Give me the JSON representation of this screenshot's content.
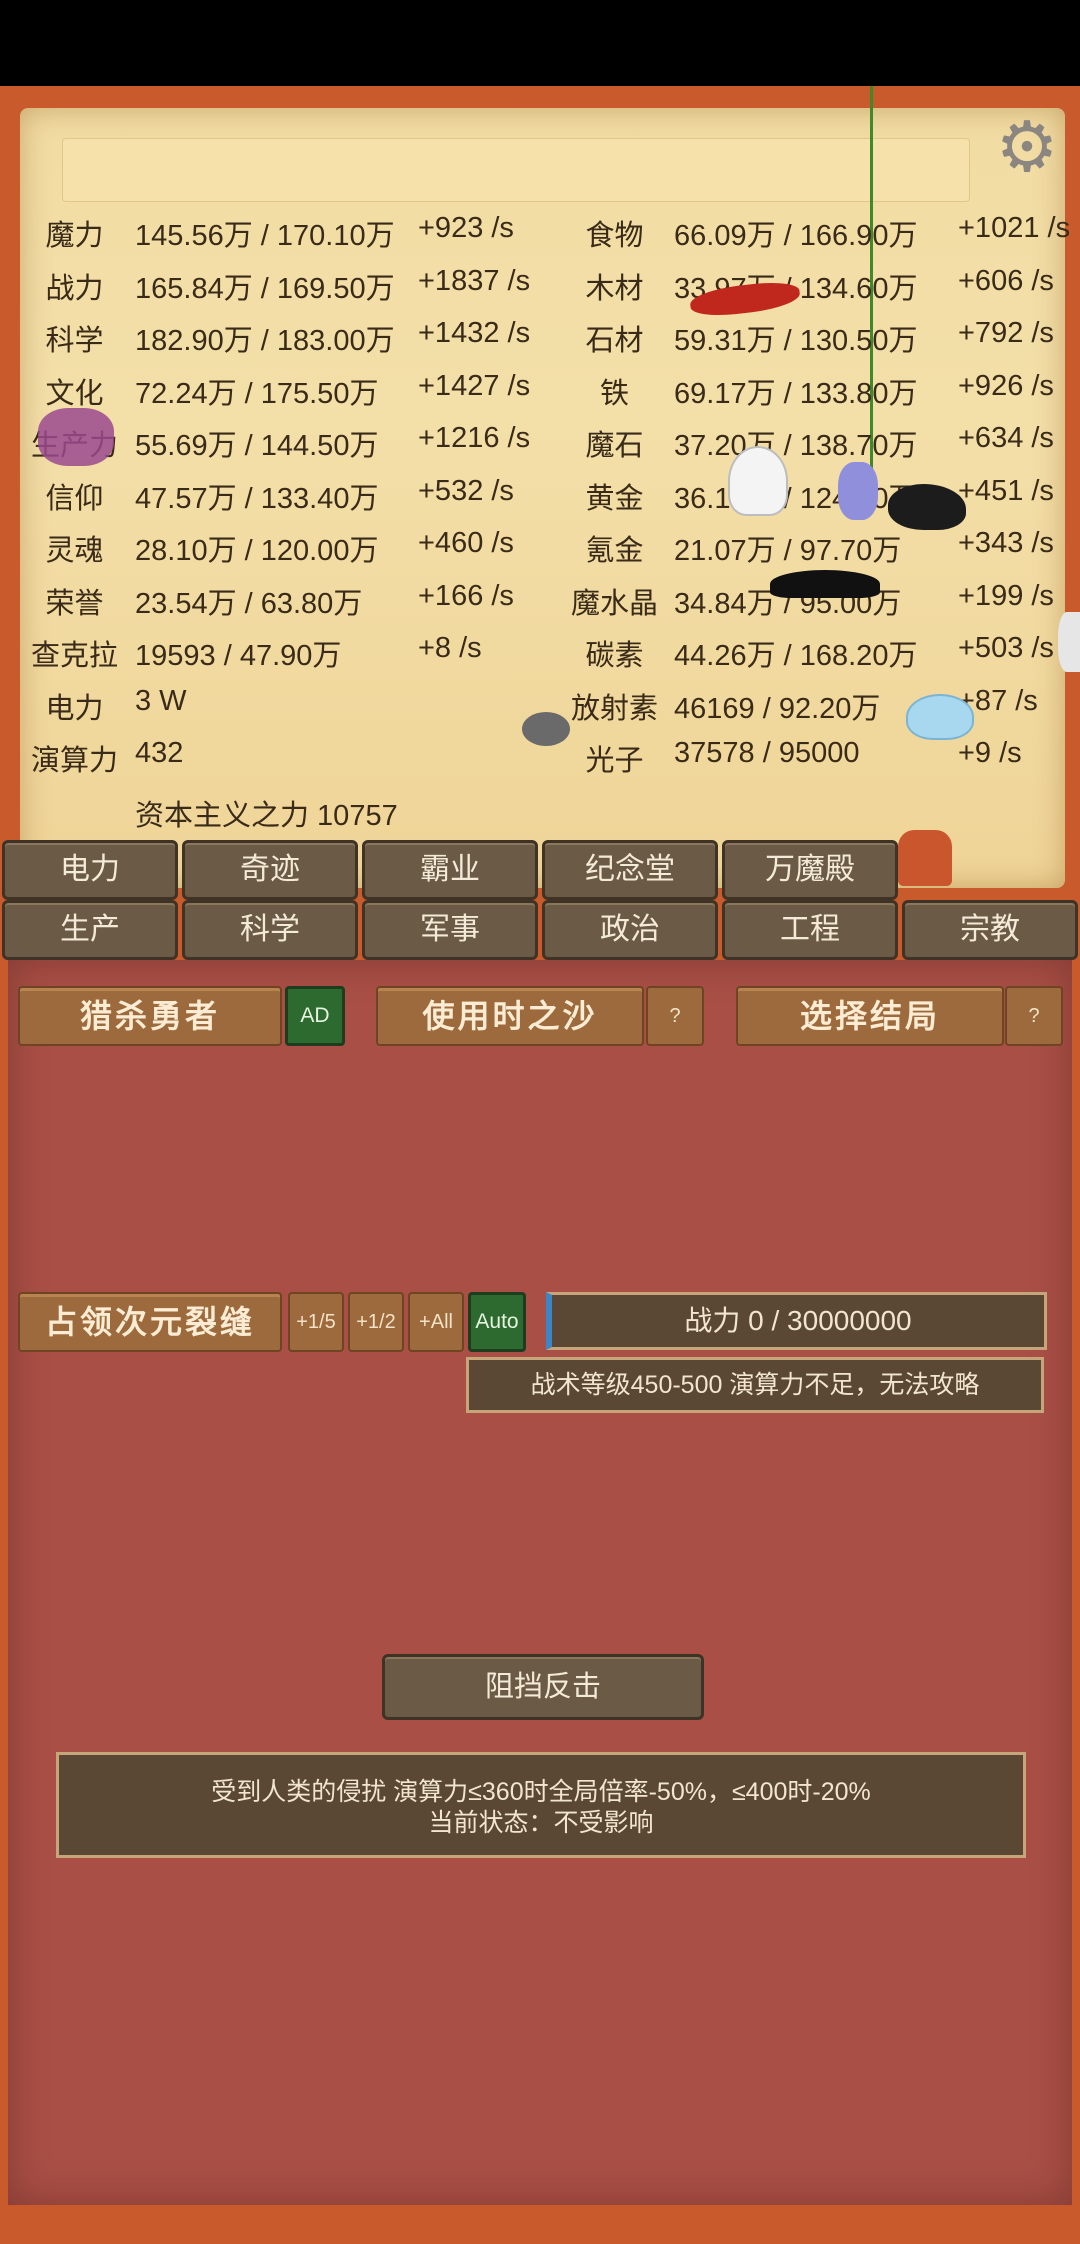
{
  "stats_left": [
    {
      "label": "魔力",
      "value": "145.56万 / 170.10万",
      "rate": "+923 /s"
    },
    {
      "label": "战力",
      "value": "165.84万 / 169.50万",
      "rate": "+1837 /s"
    },
    {
      "label": "科学",
      "value": "182.90万 / 183.00万",
      "rate": "+1432 /s"
    },
    {
      "label": "文化",
      "value": "72.24万 / 175.50万",
      "rate": "+1427 /s"
    },
    {
      "label": "生产力",
      "value": "55.69万 / 144.50万",
      "rate": "+1216 /s"
    },
    {
      "label": "信仰",
      "value": "47.57万 / 133.40万",
      "rate": "+532 /s"
    },
    {
      "label": "灵魂",
      "value": "28.10万 / 120.00万",
      "rate": "+460 /s"
    },
    {
      "label": "荣誉",
      "value": "23.54万 / 63.80万",
      "rate": "+166 /s"
    },
    {
      "label": "查克拉",
      "value": "19593 / 47.90万",
      "rate": "+8 /s"
    },
    {
      "label": "电力",
      "value": "3 W",
      "rate": ""
    },
    {
      "label": "演算力",
      "value": "432",
      "rate": ""
    }
  ],
  "stats_right": [
    {
      "label": "食物",
      "value": "66.09万 / 166.90万",
      "rate": "+1021 /s"
    },
    {
      "label": "木材",
      "value": "33.97万 / 134.60万",
      "rate": "+606 /s"
    },
    {
      "label": "石材",
      "value": "59.31万 / 130.50万",
      "rate": "+792 /s"
    },
    {
      "label": "铁",
      "value": "69.17万 / 133.80万",
      "rate": "+926 /s"
    },
    {
      "label": "魔石",
      "value": "37.20万 / 138.70万",
      "rate": "+634 /s"
    },
    {
      "label": "黄金",
      "value": "36.16万 / 124.40万",
      "rate": "+451 /s"
    },
    {
      "label": "氪金",
      "value": "21.07万 / 97.70万",
      "rate": "+343 /s"
    },
    {
      "label": "魔水晶",
      "value": "34.84万 / 95.00万",
      "rate": "+199 /s"
    },
    {
      "label": "碳素",
      "value": "44.26万 / 168.20万",
      "rate": "+503 /s"
    },
    {
      "label": "放射素",
      "value": "46169 / 92.20万",
      "rate": "+87 /s"
    },
    {
      "label": "光子",
      "value": "37578 / 95000",
      "rate": "+9 /s"
    }
  ],
  "capitalism": "资本主义之力 10757",
  "tabs_row1": [
    "电力",
    "奇迹",
    "霸业",
    "纪念堂",
    "万魔殿"
  ],
  "tabs_row2": [
    "生产",
    "科学",
    "军事",
    "政治",
    "工程",
    "宗教"
  ],
  "actions": {
    "hunt_hero": "猎杀勇者",
    "ad": "AD",
    "sands": "使用时之沙",
    "help1": "?",
    "ending": "选择结局",
    "help2": "?"
  },
  "rift": {
    "occupy": "占领次元裂缝",
    "plus_fifth": "+1/5",
    "plus_half": "+1/2",
    "plus_all": "+All",
    "auto": "Auto",
    "power": "战力 0 / 30000000",
    "tactic": "战术等级450-500 演算力不足，无法攻略"
  },
  "block": {
    "button": "阻挡反击",
    "line1": "受到人类的侵扰 演算力≤360时全局倍率-50%，≤400时-20%",
    "line2": "当前状态：不受影响"
  },
  "icons": [
    "gear-icon"
  ]
}
